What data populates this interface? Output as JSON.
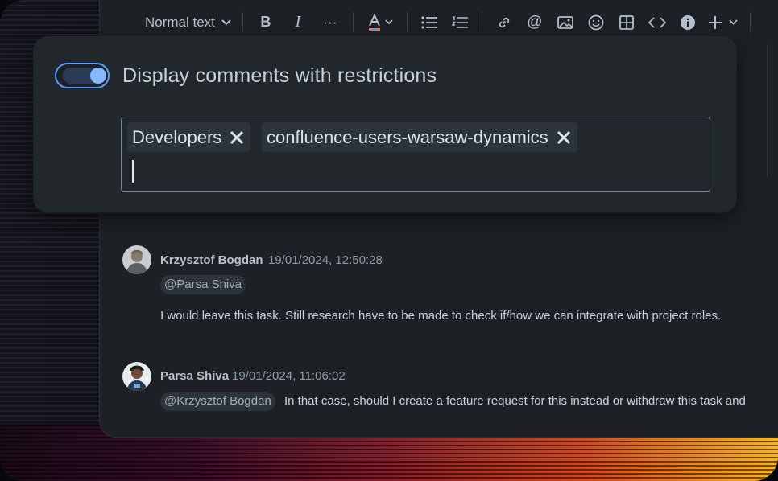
{
  "toolbar": {
    "text_style": "Normal text",
    "more": "···",
    "items": [
      "bold",
      "italic",
      "more-formatting",
      "text-color",
      "bullet-list",
      "numbered-list",
      "link",
      "mention",
      "image",
      "emoji",
      "table",
      "code",
      "info",
      "insert"
    ]
  },
  "restrictions": {
    "toggle_label": "Display comments with restrictions",
    "toggle_on": true,
    "tags": [
      {
        "label": "Developers"
      },
      {
        "label": "confluence-users-warsaw-dynamics"
      }
    ]
  },
  "comments": [
    {
      "author": "Krzysztof Bogdan",
      "timestamp": "19/01/2024, 12:50:28",
      "mention": "@Parsa Shiva",
      "text": "I would leave this task. Still research have to be made to check if/how we can integrate with project roles."
    },
    {
      "author": "Parsa Shiva",
      "timestamp": "19/01/2024, 11:06:02",
      "mention": "@Krzysztof Bogdan",
      "text": "In that case, should I create a feature request for this instead or withdraw this task and"
    }
  ],
  "colors": {
    "accent": "#579dff",
    "panel": "#22272b",
    "editor": "#1d2125"
  }
}
